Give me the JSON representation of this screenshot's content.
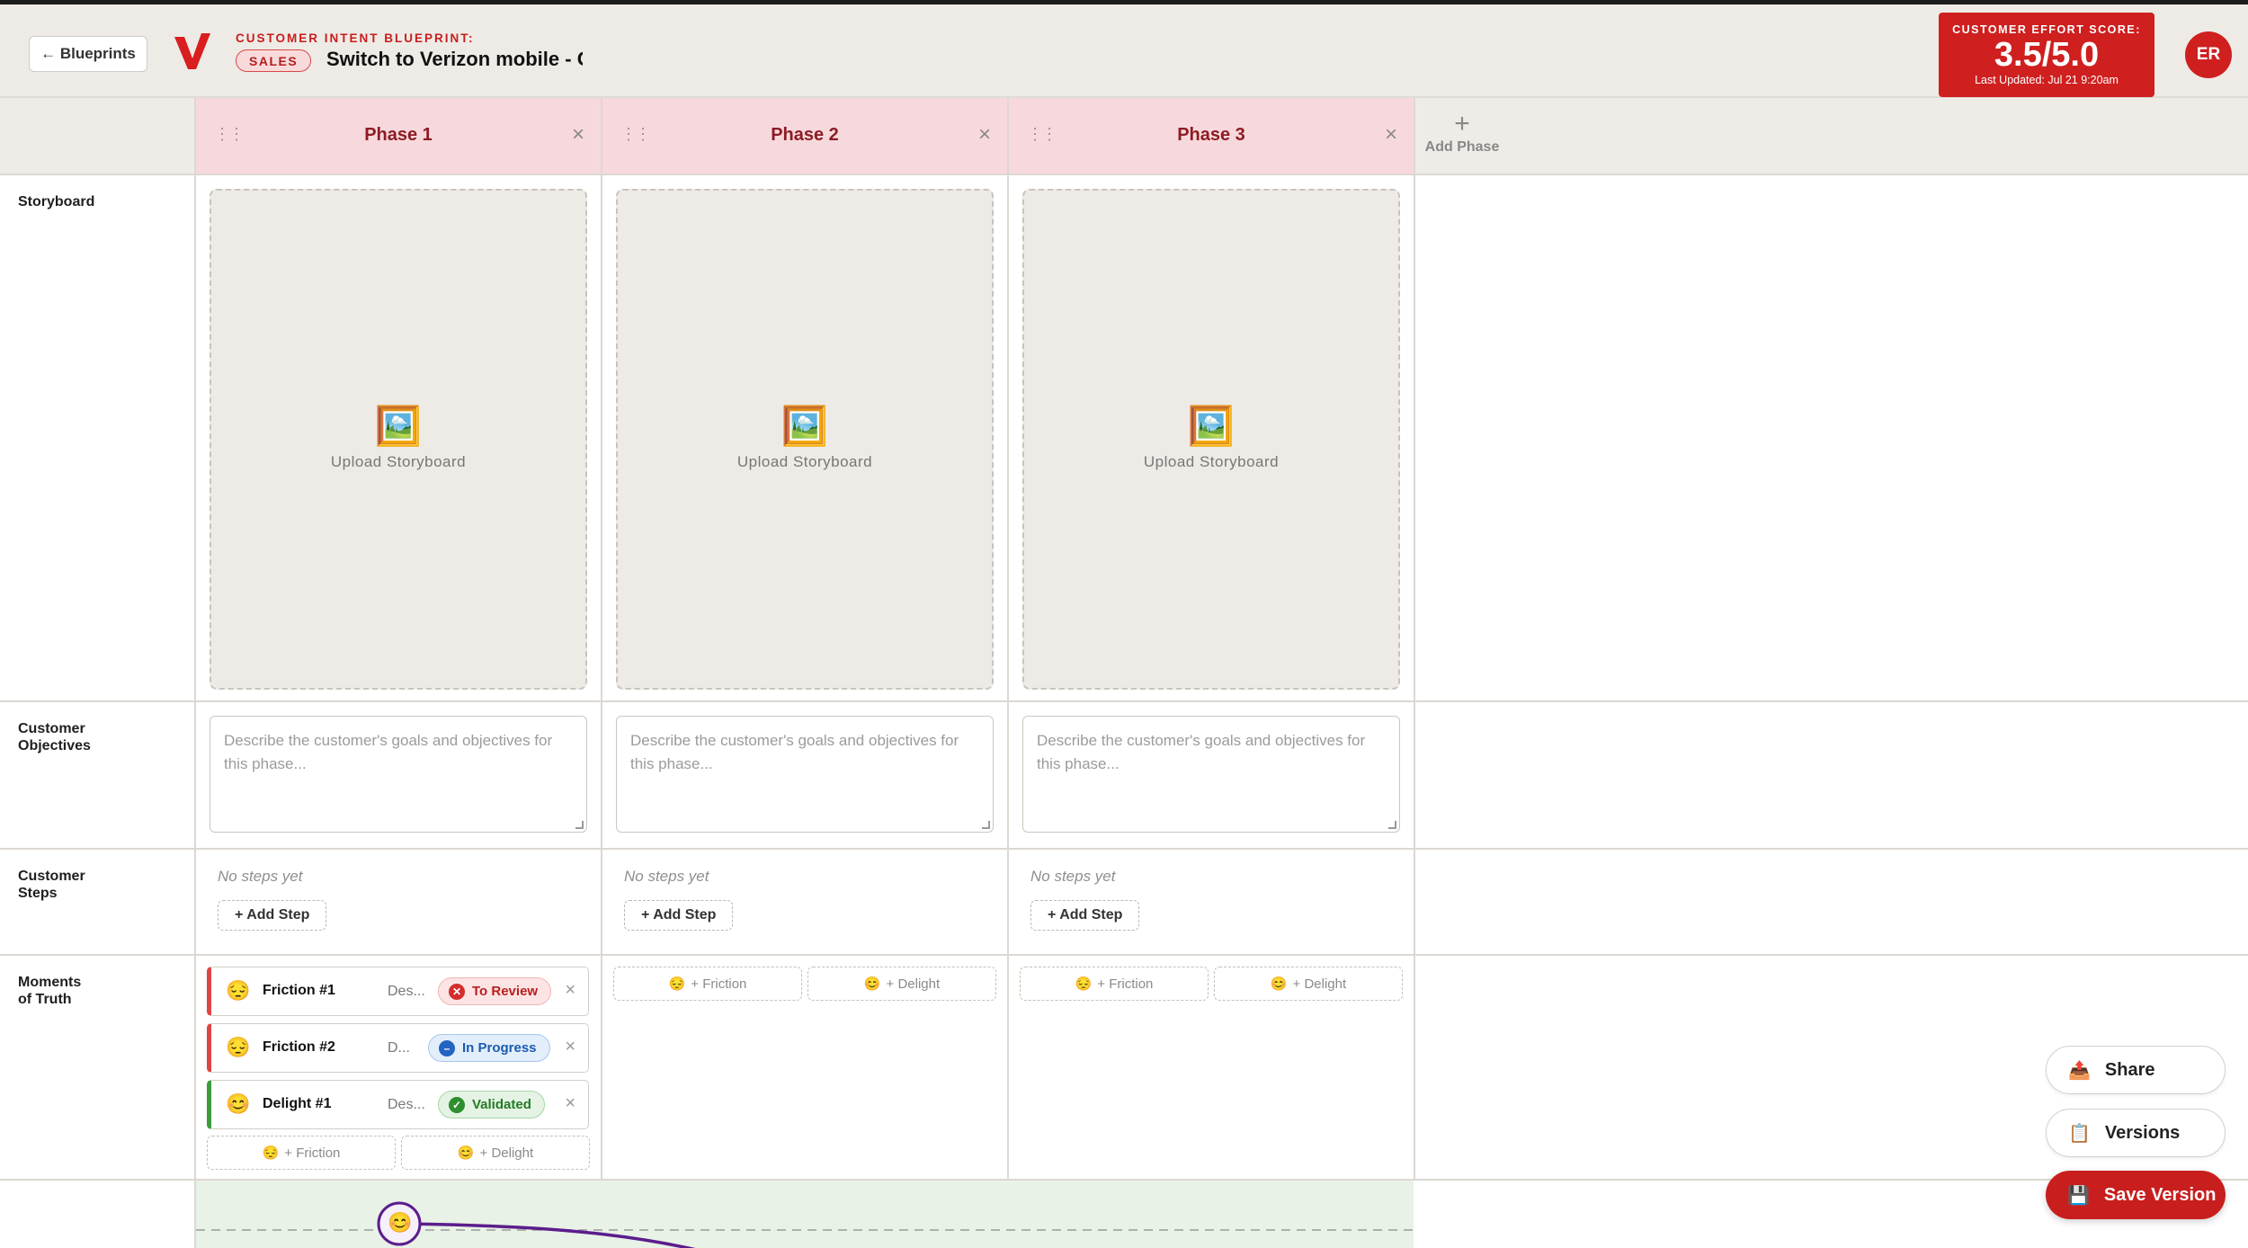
{
  "header": {
    "back_label": "← Blueprints",
    "blueprint_label": "CUSTOMER INTENT BLUEPRINT:",
    "category_badge": "SALES",
    "title": "Switch to Verizon mobile - Online",
    "score_label": "CUSTOMER EFFORT SCORE:",
    "score_value": "3.5/5.0",
    "score_updated": "Last Updated: Jul 21 9:20am",
    "avatar_initials": "ER",
    "brand_color": "#cf1f1f"
  },
  "phases": [
    {
      "name": "Phase 1"
    },
    {
      "name": "Phase 2"
    },
    {
      "name": "Phase 3"
    }
  ],
  "add_phase_label": "Add Phase",
  "rows": {
    "storyboard": "Storyboard",
    "objectives_line1": "Customer",
    "objectives_line2": "Objectives",
    "steps_line1": "Customer",
    "steps_line2": "Steps",
    "moments_line1": "Moments",
    "moments_line2": "of Truth"
  },
  "storyboard": {
    "icon": "🖼️",
    "upload_label": "Upload Storyboard"
  },
  "objectives_placeholder": "Describe the customer's goals and objectives for this phase...",
  "steps": {
    "empty_label": "No steps yet",
    "add_label": "+ Add Step"
  },
  "moments": [
    {
      "emoji": "😔",
      "title": "Friction #1",
      "desc": "Des...",
      "status": "To Review",
      "status_icon": "✕"
    },
    {
      "emoji": "😔",
      "title": "Friction #2",
      "desc": "D...",
      "status": "In Progress",
      "status_icon": "–"
    },
    {
      "emoji": "😊",
      "title": "Delight #1",
      "desc": "Des...",
      "status": "Validated",
      "status_icon": "✓"
    }
  ],
  "moment_add": {
    "friction_emoji": "😔",
    "friction_label": "+ Friction",
    "delight_emoji": "😊",
    "delight_label": "+ Delight"
  },
  "curve_emoji": "😊",
  "actions": {
    "share_label": "Share",
    "share_icon": "📤",
    "versions_label": "Versions",
    "versions_icon": "📋",
    "save_label": "Save Version",
    "save_icon": "💾"
  }
}
